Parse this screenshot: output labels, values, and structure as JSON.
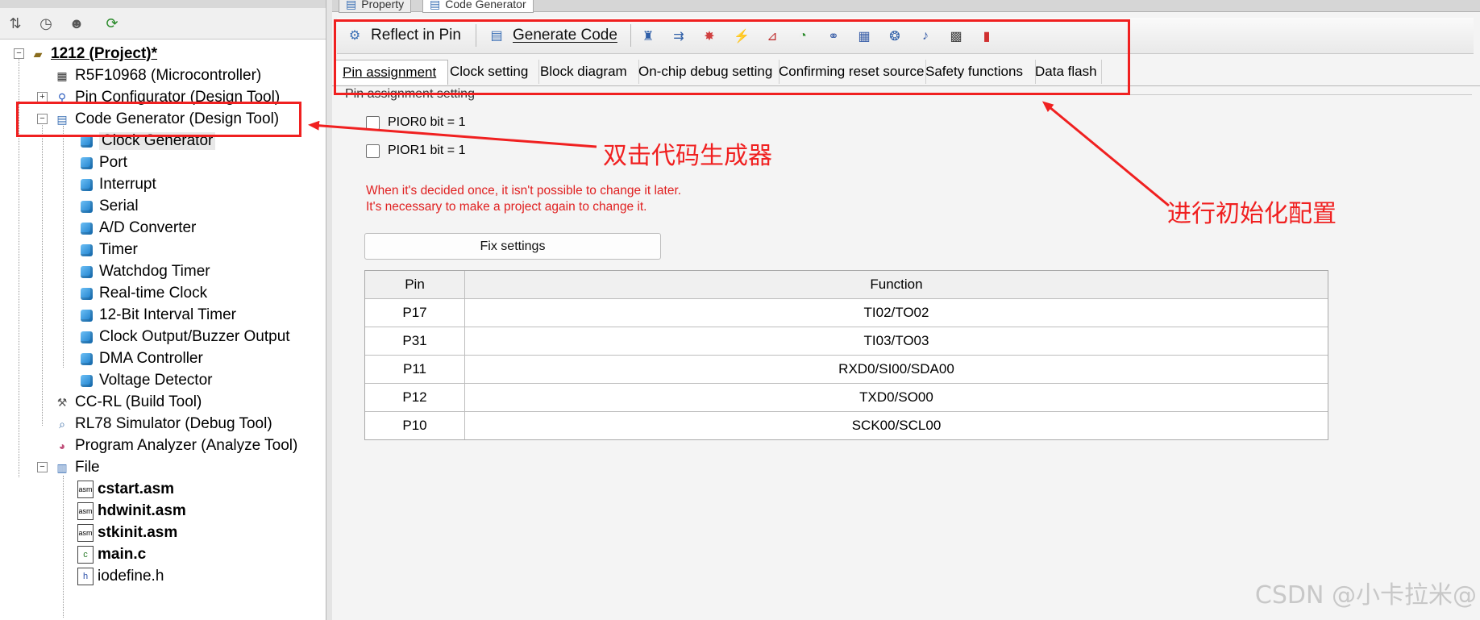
{
  "left_pane": {
    "tree": {
      "project": {
        "label": "1212 (Project)*"
      },
      "microcontroller": {
        "label": "R5F10968 (Microcontroller)"
      },
      "pin_configurator": {
        "label": "Pin Configurator (Design Tool)"
      },
      "code_generator": {
        "label": "Code Generator (Design Tool)"
      },
      "code_gen_children": [
        "Clock Generator",
        "Port",
        "Interrupt",
        "Serial",
        "A/D Converter",
        "Timer",
        "Watchdog Timer",
        "Real-time Clock",
        "12-Bit Interval Timer",
        "Clock Output/Buzzer Output",
        "DMA Controller",
        "Voltage Detector"
      ],
      "build_tool": {
        "label": "CC-RL (Build Tool)"
      },
      "debug_tool": {
        "label": "RL78 Simulator (Debug Tool)"
      },
      "analyze_tool": {
        "label": "Program Analyzer (Analyze Tool)"
      },
      "file_folder": {
        "label": "File"
      },
      "files": [
        {
          "label": "cstart.asm",
          "bold": true,
          "icon": "asm-file-icon"
        },
        {
          "label": "hdwinit.asm",
          "bold": true,
          "icon": "asm-file-icon"
        },
        {
          "label": "stkinit.asm",
          "bold": true,
          "icon": "asm-file-icon"
        },
        {
          "label": "main.c",
          "bold": true,
          "icon": "c-file-icon"
        },
        {
          "label": "iodefine.h",
          "bold": false,
          "icon": "h-file-icon"
        }
      ]
    }
  },
  "right_pane": {
    "top_tabs": [
      "Property",
      "Code Generator"
    ],
    "toolbar": {
      "reflect_label": "Reflect in Pin",
      "generate_label": "Generate Code"
    },
    "subtabs": [
      "Pin assignment",
      "Clock setting",
      "Block diagram",
      "On-chip debug setting",
      "Confirming reset source",
      "Safety functions",
      "Data flash"
    ],
    "group_title": "Pin assignment setting",
    "checkboxes": [
      "PIOR0 bit = 1",
      "PIOR1 bit = 1"
    ],
    "warning_lines": [
      "When it's decided once, it isn't possible to change it later.",
      "It's necessary to make a project again to change it."
    ],
    "fix_button": "Fix settings",
    "table": {
      "headers": [
        "Pin",
        "Function"
      ],
      "rows": [
        [
          "P17",
          "TI02/TO02"
        ],
        [
          "P31",
          "TI03/TO03"
        ],
        [
          "P11",
          "RXD0/SI00/SDA00"
        ],
        [
          "P12",
          "TXD0/SO00"
        ],
        [
          "P10",
          "SCK00/SCL00"
        ]
      ]
    }
  },
  "annotations": {
    "double_click": "双击代码生成器",
    "init_config": "进行初始化配置",
    "color": "#f02020"
  },
  "watermark": "CSDN @小卡拉米@"
}
